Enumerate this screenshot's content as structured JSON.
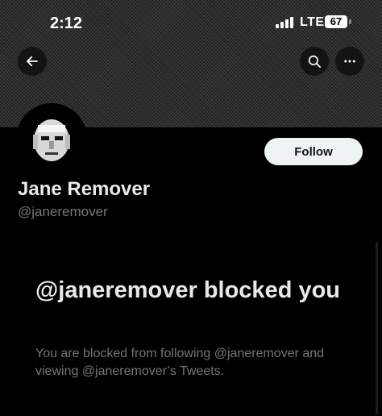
{
  "status_bar": {
    "time": "2:12",
    "network": "LTE",
    "battery": "67"
  },
  "header": {
    "back_icon": "arrow-left-icon",
    "search_icon": "search-icon",
    "more_icon": "more-horizontal-icon"
  },
  "profile": {
    "display_name": "Jane Remover",
    "handle": "@janeremover",
    "follow_label": "Follow"
  },
  "blocked": {
    "title": "@janeremover blocked you",
    "description": "You are blocked from following @janeremover and viewing @janeremover’s Tweets."
  },
  "colors": {
    "background": "#000000",
    "text_primary": "#e7e9ea",
    "text_secondary": "#71767b",
    "follow_bg": "#eff3f4"
  }
}
